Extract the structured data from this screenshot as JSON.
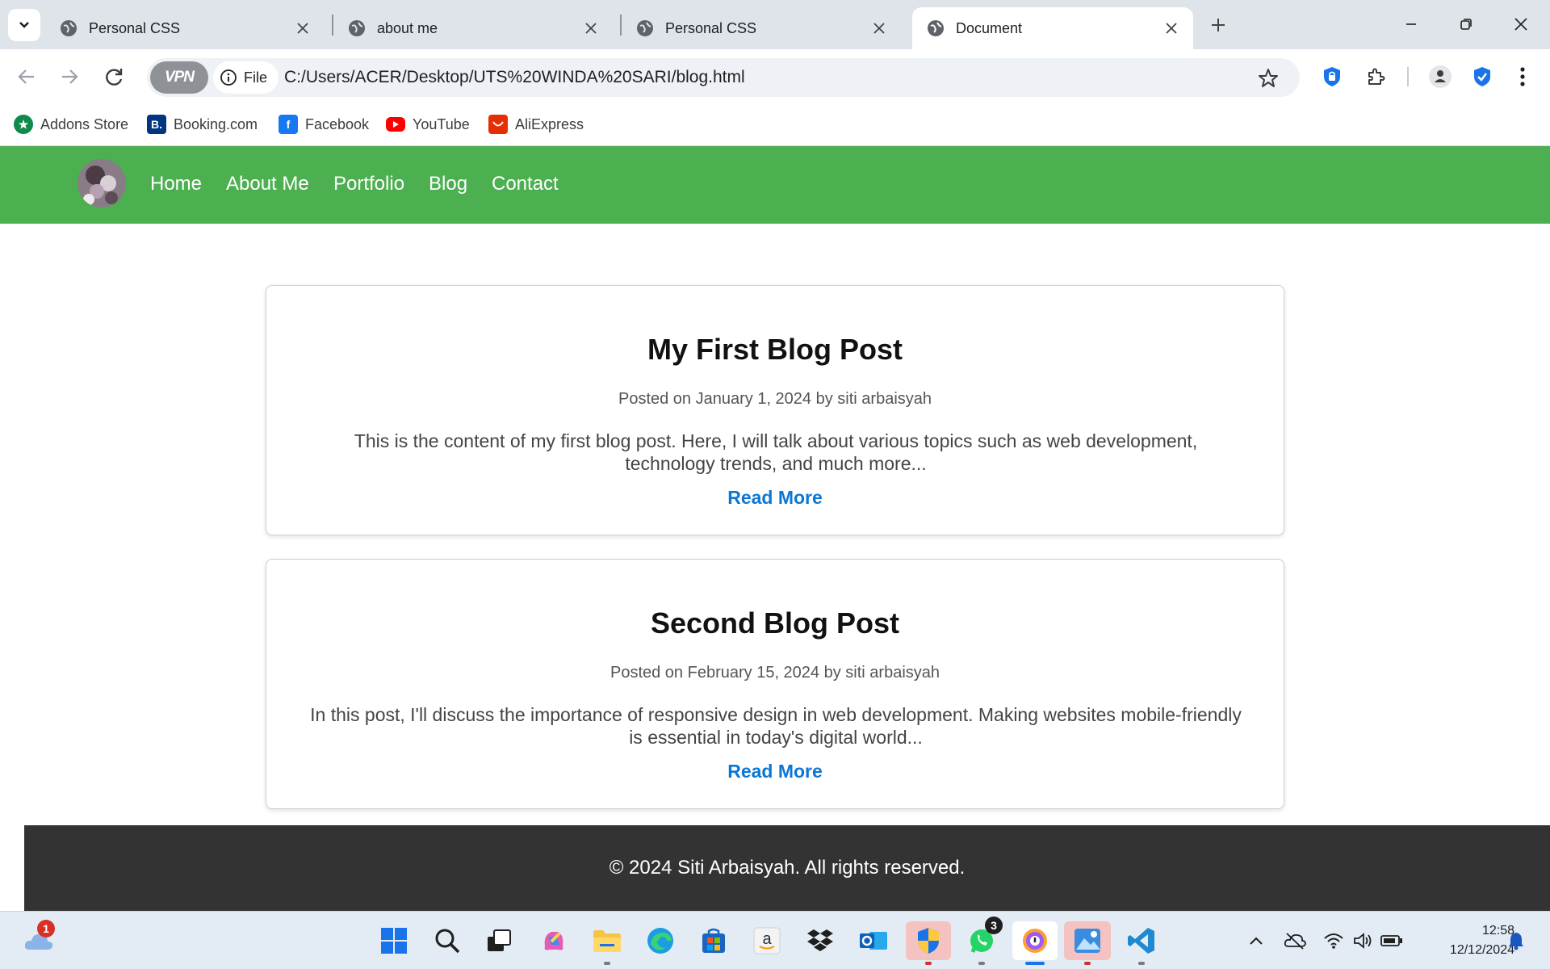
{
  "browser": {
    "tabs": [
      {
        "title": "Personal CSS",
        "active": false
      },
      {
        "title": "about me",
        "active": false
      },
      {
        "title": "Personal CSS",
        "active": false
      },
      {
        "title": "Document",
        "active": true
      }
    ],
    "vpn_label": "VPN",
    "file_chip_label": "File",
    "url": "C:/Users/ACER/Desktop/UTS%20WINDA%20SARI/blog.html",
    "bookmarks": [
      {
        "label": "Addons Store",
        "icon": "addons-store-icon",
        "color": "#0f8a4b"
      },
      {
        "label": "Booking.com",
        "icon": "booking-icon",
        "color": "#003580"
      },
      {
        "label": "Facebook",
        "icon": "facebook-icon",
        "color": "#1877f2"
      },
      {
        "label": "YouTube",
        "icon": "youtube-icon",
        "color": "#ff0000"
      },
      {
        "label": "AliExpress",
        "icon": "aliexpress-icon",
        "color": "#e62e04"
      }
    ]
  },
  "site": {
    "accent_color": "#4caf50",
    "nav": [
      "Home",
      "About Me",
      "Portfolio",
      "Blog",
      "Contact"
    ],
    "posts": [
      {
        "title": "My First Blog Post",
        "meta": "Posted on January 1, 2024 by siti arbaisyah",
        "body": "This is the content of my first blog post. Here, I will talk about various topics such as web development, technology trends, and much more...",
        "link": "Read More"
      },
      {
        "title": "Second Blog Post",
        "meta": "Posted on February 15, 2024 by siti arbaisyah",
        "body": "In this post, I'll discuss the importance of responsive design in web development. Making websites mobile-friendly is essential in today's digital world...",
        "link": "Read More"
      }
    ],
    "footer": "© 2024 Siti Arbaisyah. All rights reserved."
  },
  "taskbar": {
    "weather_badge": "1",
    "whatsapp_badge": "3",
    "time": "12:58",
    "date": "12/12/2024"
  }
}
